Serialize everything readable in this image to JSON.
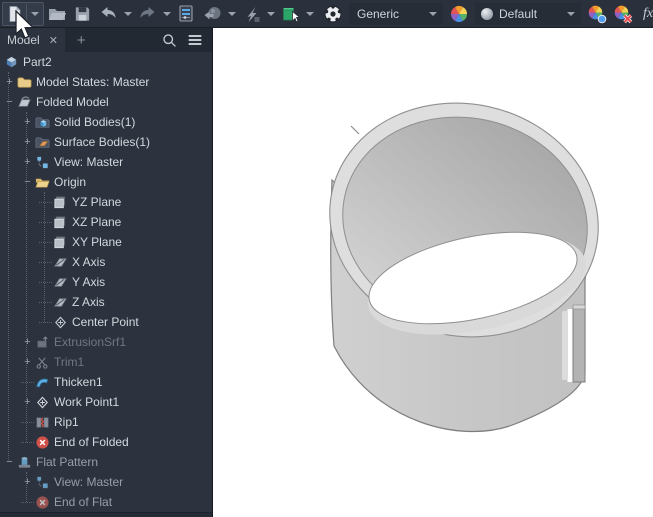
{
  "toolbar": {
    "material_value": "Generic",
    "appearance_value": "Default",
    "fx_label": "fx",
    "icons": [
      "new-document-icon",
      "open-folder-icon",
      "save-icon",
      "undo-icon",
      "redo-icon",
      "display-update-icon",
      "return-sphere-icon",
      "local-update-icon",
      "select-icon",
      "material-ball-icon",
      "appearance-wheel-icon",
      "appearance-sphere-icon",
      "adjust-appearance-icon",
      "clear-appearance-icon",
      "parameters-fx-icon",
      "measure-icon"
    ]
  },
  "tabbar": {
    "tab_label": "Model",
    "close_glyph": "✕",
    "add_glyph": "+"
  },
  "tree": {
    "items": [
      {
        "label": "Part2",
        "expander": "",
        "icon": "part"
      },
      {
        "label": "Model States: Master",
        "expander": "+",
        "icon": "folder"
      },
      {
        "label": "Folded Model",
        "expander": "−",
        "icon": "folded-model"
      },
      {
        "label": "Solid Bodies(1)",
        "expander": "+",
        "icon": "solid-bodies-folder"
      },
      {
        "label": "Surface Bodies(1)",
        "expander": "+",
        "icon": "surface-bodies-folder"
      },
      {
        "label": "View: Master",
        "expander": "+",
        "icon": "view"
      },
      {
        "label": "Origin",
        "expander": "−",
        "icon": "origin-folder"
      },
      {
        "label": "YZ Plane",
        "expander": "",
        "icon": "plane"
      },
      {
        "label": "XZ Plane",
        "expander": "",
        "icon": "plane"
      },
      {
        "label": "XY Plane",
        "expander": "",
        "icon": "plane"
      },
      {
        "label": "X Axis",
        "expander": "",
        "icon": "axis"
      },
      {
        "label": "Y Axis",
        "expander": "",
        "icon": "axis"
      },
      {
        "label": "Z Axis",
        "expander": "",
        "icon": "axis"
      },
      {
        "label": "Center Point",
        "expander": "",
        "icon": "center-point"
      },
      {
        "label": "ExtrusionSrf1",
        "expander": "+",
        "icon": "extrusion-surface",
        "state": "consumed"
      },
      {
        "label": "Trim1",
        "expander": "+",
        "icon": "trim",
        "state": "consumed"
      },
      {
        "label": "Thicken1",
        "expander": "",
        "icon": "thicken"
      },
      {
        "label": "Work Point1",
        "expander": "+",
        "icon": "work-point"
      },
      {
        "label": "Rip1",
        "expander": "",
        "icon": "rip"
      },
      {
        "label": "End of Folded",
        "expander": "",
        "icon": "end-of-folded"
      },
      {
        "label": "Flat Pattern",
        "expander": "−",
        "icon": "flat-pattern",
        "state": "inactive"
      },
      {
        "label": "View: Master",
        "expander": "+",
        "icon": "view",
        "state": "inactive"
      },
      {
        "label": "End of Flat",
        "expander": "",
        "icon": "end-of-flat",
        "state": "inactive"
      }
    ]
  },
  "viewport": {
    "content": "cylindrical sheet-metal part with rip gap",
    "colors": {
      "part_body": "#c9c9c9",
      "part_rim": "#dedede",
      "part_inner": "#ababab",
      "outline": "#7e7e7e",
      "background": "#ffffff"
    }
  },
  "colors": {
    "toolbar_bg": "#2b313c",
    "panel_bg": "#2d333e",
    "tabbar_bg": "#232933",
    "text": "#d3d8de",
    "dim_text": "#6e7784",
    "status_red": "#d0504a",
    "accent_blue": "#74b7e4"
  }
}
